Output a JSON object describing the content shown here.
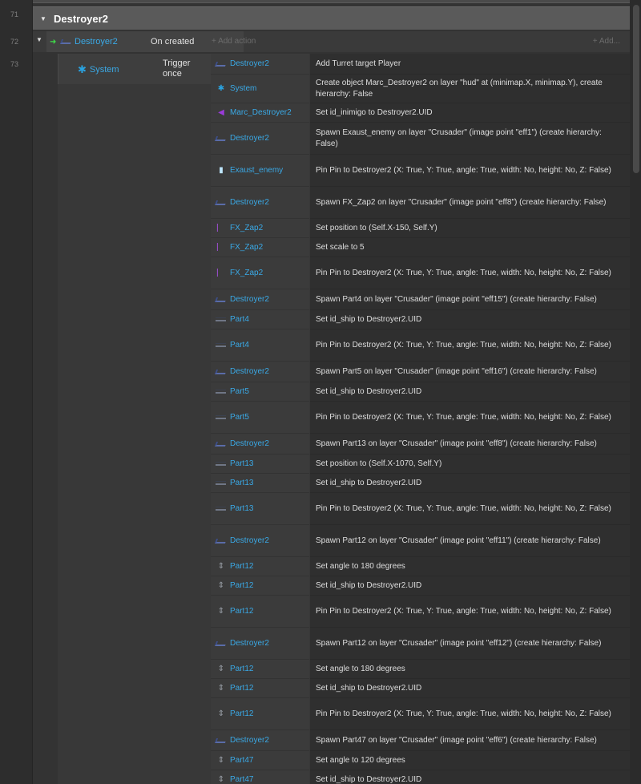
{
  "line_numbers": [
    "71",
    "72",
    "73"
  ],
  "group": {
    "title": "Destroyer2"
  },
  "event": {
    "object": "Destroyer2",
    "condition": "On created",
    "add_action": "+ Add action",
    "add_more": "+ Add..."
  },
  "sub_event": {
    "object": "System",
    "condition_line1": "Trigger",
    "condition_line2": "once"
  },
  "actions": [
    {
      "obj": "Destroyer2",
      "icon": "ship-icon",
      "text": "Add  Turret target  Player"
    },
    {
      "obj": "System",
      "icon": "gear-icon",
      "text": "Create object  Marc_Destroyer2 on layer \"hud\" at (minimap.X, minimap.Y), create hierarchy: False"
    },
    {
      "obj": "Marc_Destroyer2",
      "icon": "marker-icon",
      "text": "Set id_inimigo to Destroyer2.UID"
    },
    {
      "obj": "Destroyer2",
      "icon": "ship-icon",
      "text": "Spawn  Exaust_enemy on layer \"Crusader\" (image point \"eff1\") (create hierarchy: False)"
    },
    {
      "obj": "Exaust_enemy",
      "icon": "exhaust-icon",
      "text": "Pin Pin to  Destroyer2 (X: True, Y: True, angle: True, width: No, height: No, Z: False)"
    },
    {
      "obj": "Destroyer2",
      "icon": "ship-icon",
      "text": "Spawn  FX_Zap2 on layer \"Crusader\" (image point \"eff8\") (create hierarchy: False)"
    },
    {
      "obj": "FX_Zap2",
      "icon": "zap-icon",
      "text": "Set position to (Self.X-150, Self.Y)"
    },
    {
      "obj": "FX_Zap2",
      "icon": "zap-icon",
      "text": "Set scale to 5"
    },
    {
      "obj": "FX_Zap2",
      "icon": "zap-icon",
      "text": "Pin Pin to  Destroyer2 (X: True, Y: True, angle: True, width: No, height: No, Z: False)"
    },
    {
      "obj": "Destroyer2",
      "icon": "ship-icon",
      "text": "Spawn  Part4 on layer \"Crusader\" (image point \"eff15\") (create hierarchy: False)"
    },
    {
      "obj": "Part4",
      "icon": "part-icon",
      "text": "Set id_ship to Destroyer2.UID"
    },
    {
      "obj": "Part4",
      "icon": "part-icon",
      "text": "Pin Pin to  Destroyer2 (X: True, Y: True, angle: True, width: No, height: No, Z: False)"
    },
    {
      "obj": "Destroyer2",
      "icon": "ship-icon",
      "text": "Spawn  Part5 on layer \"Crusader\" (image point \"eff16\") (create hierarchy: False)"
    },
    {
      "obj": "Part5",
      "icon": "part-icon",
      "text": "Set id_ship to Destroyer2.UID"
    },
    {
      "obj": "Part5",
      "icon": "part-icon",
      "text": "Pin Pin to  Destroyer2 (X: True, Y: True, angle: True, width: No, height: No, Z: False)"
    },
    {
      "obj": "Destroyer2",
      "icon": "ship-icon",
      "text": "Spawn  Part13 on layer \"Crusader\" (image point \"eff8\") (create hierarchy: False)"
    },
    {
      "obj": "Part13",
      "icon": "part-icon",
      "text": "Set position to (Self.X-1070, Self.Y)"
    },
    {
      "obj": "Part13",
      "icon": "part-icon",
      "text": "Set id_ship to Destroyer2.UID"
    },
    {
      "obj": "Part13",
      "icon": "part-icon",
      "text": "Pin Pin to  Destroyer2 (X: True, Y: True, angle: True, width: No, height: No, Z: False)"
    },
    {
      "obj": "Destroyer2",
      "icon": "ship-icon",
      "text": "Spawn  Part12 on layer \"Crusader\" (image point \"eff11\") (create hierarchy: False)"
    },
    {
      "obj": "Part12",
      "icon": "vertical-part-icon",
      "text": "Set angle to 180 degrees"
    },
    {
      "obj": "Part12",
      "icon": "vertical-part-icon",
      "text": "Set id_ship to Destroyer2.UID"
    },
    {
      "obj": "Part12",
      "icon": "vertical-part-icon",
      "text": "Pin Pin to  Destroyer2 (X: True, Y: True, angle: True, width: No, height: No, Z: False)"
    },
    {
      "obj": "Destroyer2",
      "icon": "ship-icon",
      "text": "Spawn  Part12 on layer \"Crusader\" (image point \"eff12\") (create hierarchy: False)"
    },
    {
      "obj": "Part12",
      "icon": "vertical-part-icon",
      "text": "Set angle to 180 degrees"
    },
    {
      "obj": "Part12",
      "icon": "vertical-part-icon",
      "text": "Set id_ship to Destroyer2.UID"
    },
    {
      "obj": "Part12",
      "icon": "vertical-part-icon",
      "text": "Pin Pin to  Destroyer2 (X: True, Y: True, angle: True, width: No, height: No, Z: False)"
    },
    {
      "obj": "Destroyer2",
      "icon": "ship-icon",
      "text": "Spawn  Part47 on layer \"Crusader\" (image point \"eff6\") (create hierarchy: False)"
    },
    {
      "obj": "Part47",
      "icon": "vertical-part-icon",
      "text": "Set angle to 120 degrees"
    },
    {
      "obj": "Part47",
      "icon": "vertical-part-icon",
      "text": "Set id_ship to Destroyer2.UID"
    }
  ]
}
